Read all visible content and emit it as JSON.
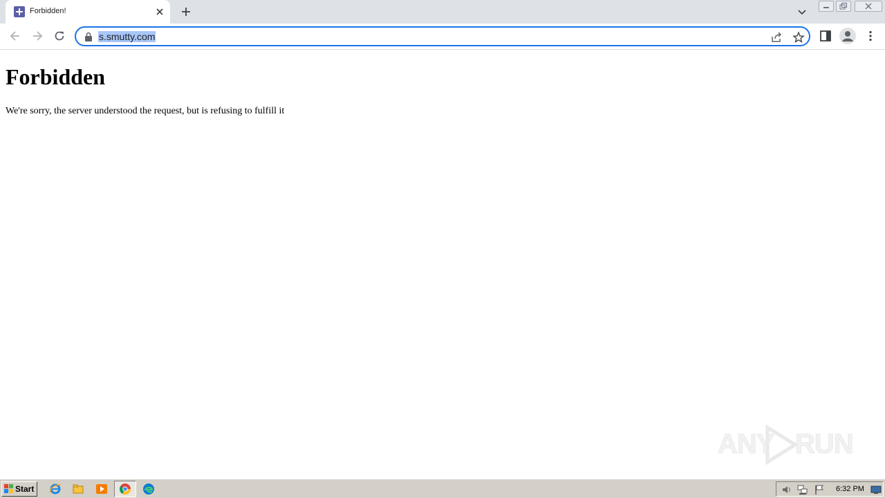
{
  "browser": {
    "tab": {
      "title": "Forbidden!"
    },
    "address_bar": {
      "url": "s.smutty.com"
    }
  },
  "page": {
    "heading": "Forbidden",
    "message": "We're sorry, the server understood the request, but is refusing to fulfill it"
  },
  "watermark": {
    "left_text": "ANY",
    "right_text": "RUN"
  },
  "taskbar": {
    "start_label": "Start",
    "clock": "6:32 PM"
  },
  "colors": {
    "tabstrip": "#dee1e6",
    "omnibox_focus": "#1a73e8",
    "url_selection": "#a8c7fa",
    "taskbar": "#d4d0c8"
  }
}
